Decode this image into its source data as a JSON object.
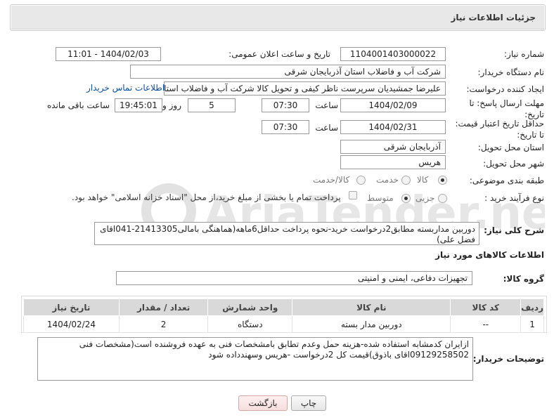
{
  "panel": {
    "title": "جزئیات اطلاعات نیاز"
  },
  "fields": {
    "need_number_label": "شماره نیاز:",
    "need_number": "1104001403000022",
    "announce_label": "تاریخ و ساعت اعلان عمومی:",
    "announce_value": "1404/02/03 - 11:01",
    "buyer_org_label": "نام دستگاه خریدار:",
    "buyer_org": "شرکت آب و فاضلاب استان آذربایجان شرقی",
    "creator_label": "ایجاد کننده درخواست:",
    "creator": "علیرضا جمشیدیان سرپرست ناظر کیفی و تحویل کالا شرکت آب و فاضلاب استان",
    "contact_link": "اطلاعات تماس خریدار",
    "deadline_label": "مهلت ارسال پاسخ: تا تاریخ:",
    "deadline_date": "1404/02/09",
    "time_label": "ساعت",
    "deadline_time": "07:30",
    "days_value": "5",
    "days_label": "روز و",
    "remaining_time": "19:45:01",
    "remaining_label": "ساعت باقی مانده",
    "validity_label": "حداقل تاریخ اعتبار قیمت: تا تاریخ:",
    "validity_date": "1404/02/31",
    "validity_time": "07:30",
    "province_label": "استان محل تحویل:",
    "province": "آذربایجان شرقی",
    "city_label": "شهر محل تحویل:",
    "city": "هریس",
    "category_label": "طبقه بندی موضوعی:",
    "category_options": [
      "کالا",
      "خدمت",
      "کالا/خدمت"
    ],
    "purchase_type_label": "نوع فرآیند خرید :",
    "purchase_options": [
      "جزیی",
      "متوسط"
    ],
    "payment_note": "پرداخت تمام یا بخشی از مبلغ خرید،از محل \"اسناد خزانه اسلامی\" خواهد بود."
  },
  "description": {
    "label": "شرح کلی نیاز:",
    "text": "دوربین مداربسته مطابق2درخواست خرید-نحوه پرداخت حداقل6ماهه(هماهنگی بامالی21413305-041اقای فضل علی)"
  },
  "goods": {
    "section_title": "اطلاعات کالاهای مورد نیاز",
    "group_label": "گروه کالا:",
    "group_value": "تجهیزات دفاعی، ایمنی و امنیتی",
    "columns": [
      "ردیف",
      "کد کالا",
      "نام کالا",
      "واحد شمارش",
      "تعداد / مقدار",
      "تاریخ نیاز"
    ],
    "rows": [
      {
        "row": "1",
        "code": "--",
        "name": "دوربین مدار بسته",
        "unit": "دستگاه",
        "qty": "2",
        "date": "1404/02/24"
      }
    ]
  },
  "buyer_notes": {
    "label": "توضیحات خریدار:",
    "text": "ازایران کدمشابه استفاده شده-هزینه حمل وعدم تطابق بامشخصات فنی به عهده فروشنده است(مشخصات فنی 09129258502اقای باذوق)قیمت کل 2درخواست -هریس وسهندداده شود"
  },
  "buttons": {
    "print": "چاپ",
    "back": "بازگشت"
  },
  "watermark": "AriaTender.neT"
}
